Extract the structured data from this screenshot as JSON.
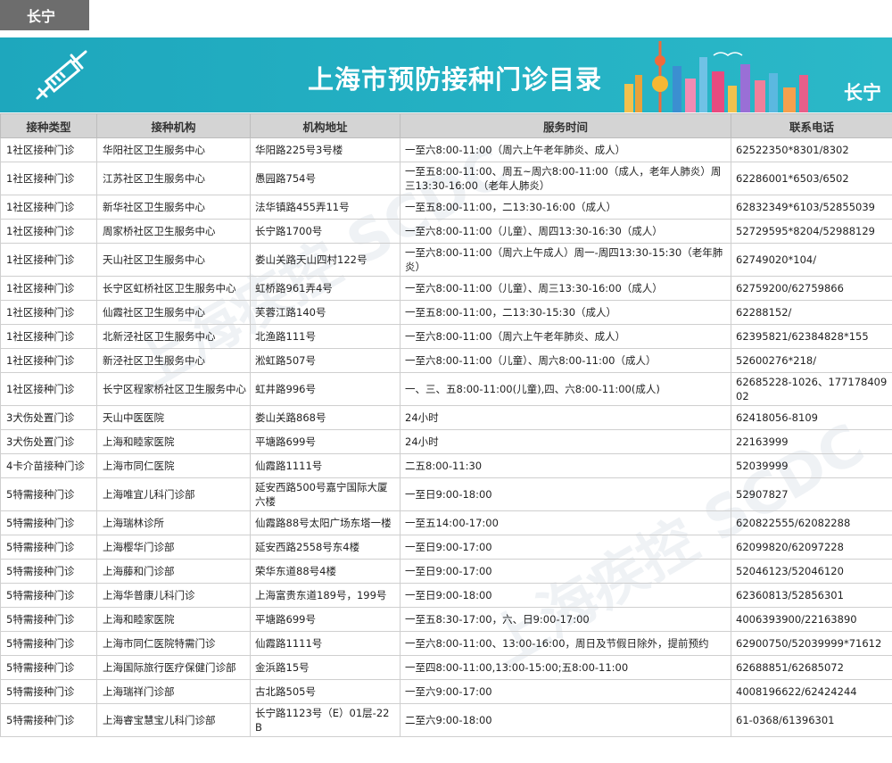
{
  "district_tab": "长宁",
  "banner": {
    "title": "上海市预防接种门诊目录",
    "district": "长宁",
    "accent": "#1ea7bd"
  },
  "table": {
    "headers": [
      "接种类型",
      "接种机构",
      "机构地址",
      "服务时间",
      "联系电话"
    ],
    "rows": [
      [
        "1社区接种门诊",
        "华阳社区卫生服务中心",
        "华阳路225号3号楼",
        "一至六8:00-11:00（周六上午老年肺炎、成人）",
        "62522350*8301/8302"
      ],
      [
        "1社区接种门诊",
        "江苏社区卫生服务中心",
        "愚园路754号",
        "一至五8:00-11:00、周五~周六8:00-11:00（成人，老年人肺炎）周三13:30-16:00（老年人肺炎）",
        "62286001*6503/6502"
      ],
      [
        "1社区接种门诊",
        "新华社区卫生服务中心",
        "法华镇路455弄11号",
        "一至五8:00-11:00，二13:30-16:00（成人）",
        "62832349*6103/52855039"
      ],
      [
        "1社区接种门诊",
        "周家桥社区卫生服务中心",
        "长宁路1700号",
        "一至六8:00-11:00（儿童）、周四13:30-16:30（成人）",
        "52729595*8204/52988129"
      ],
      [
        "1社区接种门诊",
        "天山社区卫生服务中心",
        "娄山关路天山四村122号",
        "一至六8:00-11:00（周六上午成人）周一-周四13:30-15:30（老年肺炎）",
        "62749020*104/"
      ],
      [
        "1社区接种门诊",
        "长宁区虹桥社区卫生服务中心",
        "虹桥路961弄4号",
        "一至六8:00-11:00（儿童）、周三13:30-16:00（成人）",
        "62759200/62759866"
      ],
      [
        "1社区接种门诊",
        "仙霞社区卫生服务中心",
        "芙蓉江路140号",
        "一至五8:00-11:00，二13:30-15:30（成人）",
        "62288152/"
      ],
      [
        "1社区接种门诊",
        "北新泾社区卫生服务中心",
        "北渔路111号",
        "一至六8:00-11:00（周六上午老年肺炎、成人）",
        "62395821/62384828*155"
      ],
      [
        "1社区接种门诊",
        "新泾社区卫生服务中心",
        "淞虹路507号",
        "一至六8:00-11:00（儿童）、周六8:00-11:00（成人）",
        "52600276*218/"
      ],
      [
        "1社区接种门诊",
        "长宁区程家桥社区卫生服务中心",
        "虹井路996号",
        "一、三、五8:00-11:00(儿童),四、六8:00-11:00(成人)",
        "62685228-1026、17717840902"
      ],
      [
        "3犬伤处置门诊",
        "天山中医医院",
        "娄山关路868号",
        "24小时",
        "62418056-8109"
      ],
      [
        "3犬伤处置门诊",
        "上海和睦家医院",
        "平塘路699号",
        "24小时",
        "22163999"
      ],
      [
        "4卡介苗接种门诊",
        "上海市同仁医院",
        "仙霞路1111号",
        "二五8:00-11:30",
        "52039999"
      ],
      [
        "5特需接种门诊",
        "上海唯宜儿科门诊部",
        "延安西路500号嘉宁国际大厦六楼",
        "一至日9:00-18:00",
        "52907827"
      ],
      [
        "5特需接种门诊",
        "上海瑞林诊所",
        "仙霞路88号太阳广场东塔一楼",
        "一至五14:00-17:00",
        "620822555/62082288"
      ],
      [
        "5特需接种门诊",
        "上海樱华门诊部",
        "延安西路2558号东4楼",
        "一至日9:00-17:00",
        "62099820/62097228"
      ],
      [
        "5特需接种门诊",
        "上海藤和门诊部",
        "荣华东道88号4楼",
        "一至日9:00-17:00",
        "52046123/52046120"
      ],
      [
        "5特需接种门诊",
        "上海华普康儿科门诊",
        "上海富贵东道189号，199号",
        "一至日9:00-18:00",
        "62360813/52856301"
      ],
      [
        "5特需接种门诊",
        "上海和睦家医院",
        "平塘路699号",
        "一至五8:30-17:00，六、日9:00-17:00",
        "4006393900/22163890"
      ],
      [
        "5特需接种门诊",
        "上海市同仁医院特需门诊",
        "仙霞路1111号",
        "一至六8:00-11:00、13:00-16:00，周日及节假日除外，提前预约",
        "62900750/52039999*71612"
      ],
      [
        "5特需接种门诊",
        "上海国际旅行医疗保健门诊部",
        "金浜路15号",
        "一至四8:00-11:00,13:00-15:00;五8:00-11:00",
        "62688851/62685072"
      ],
      [
        "5特需接种门诊",
        "上海瑞祥门诊部",
        "古北路505号",
        "一至六9:00-17:00",
        "4008196622/62424244"
      ],
      [
        "5特需接种门诊",
        "上海睿宝慧宝儿科门诊部",
        "长宁路1123号（E）01层-22B",
        "二至六9:00-18:00",
        "61-0368/61396301"
      ]
    ]
  },
  "watermark_text": "上海疾控 SCDC"
}
